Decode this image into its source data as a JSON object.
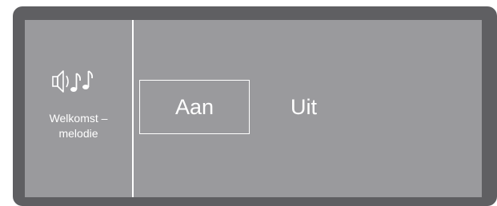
{
  "setting": {
    "icon": "speaker-music-notes-icon",
    "label": "Welkomst –\nmelodie"
  },
  "options": {
    "on_label": "Aan",
    "off_label": "Uit",
    "selected": "Aan"
  },
  "colors": {
    "bezel": "#5f5f62",
    "screen": "#9a9a9d",
    "foreground": "#ffffff"
  }
}
